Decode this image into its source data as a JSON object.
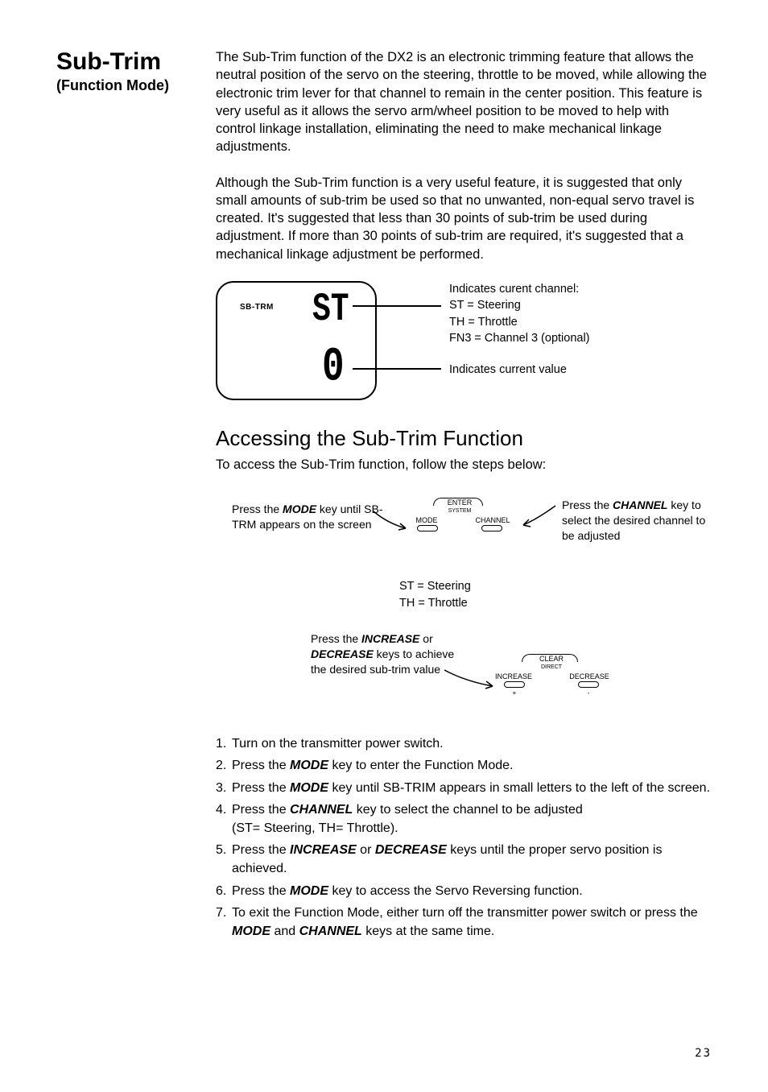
{
  "side": {
    "title": "Sub-Trim",
    "subtitle": "(Function Mode)"
  },
  "para1": "The Sub-Trim function of the DX2 is an electronic trimming feature that allows the neutral position of the servo on the steering, throttle to be moved, while allowing the electronic trim lever for that channel to remain in the center position. This feature is very useful as it allows the servo arm/wheel position to be moved to help with control linkage installation, eliminating the need to make mechanical linkage adjustments.",
  "para2": "Although the Sub-Trim function is a very useful feature, it is suggested that only small amounts of sub-trim be used so that no unwanted, non-equal servo travel is created. It's suggested that less than 30 points of sub-trim be used during adjustment. If more than 30 points of sub-trim are required, it's suggested that a mechanical linkage adjustment be performed.",
  "lcd": {
    "label": "SB-TRM",
    "seg1": "ST",
    "seg2": "0",
    "cap_top_line1": "Indicates curent channel:",
    "cap_top_line2": "ST = Steering",
    "cap_top_line3": "TH = Throttle",
    "cap_top_line4": "FN3 = Channel 3 (optional)",
    "cap_bot": "Indicates current value"
  },
  "h2": "Accessing the Sub-Trim Function",
  "h2_sub": "To access the Sub-Trim function, follow the steps below:",
  "d1": {
    "left_pre": "Press the ",
    "left_key": "MODE",
    "left_post": " key until SB-TRM appears on the screen",
    "right_pre": "Press the ",
    "right_key": "CHANNEL",
    "right_post": " key to select the desired channel to be adjusted",
    "btn_top": "ENTER",
    "btn_sys": "SYSTEM",
    "btn_l": "MODE",
    "btn_r": "CHANNEL",
    "mid1": "ST = Steering",
    "mid2": "TH = Throttle"
  },
  "d2": {
    "cap_pre": "Press the ",
    "cap_k1": "INCREASE",
    "cap_mid": " or ",
    "cap_k2": "DECREASE",
    "cap_post": " keys to achieve the desired sub-trim value",
    "btn_top": "CLEAR",
    "btn_sys": "DIRECT",
    "btn_l": "INCREASE",
    "btn_r": "DECREASE",
    "sign_l": "+",
    "sign_r": "-"
  },
  "steps": {
    "s1": "Turn on the transmitter power switch.",
    "s2a": "Press the ",
    "s2k": "MODE",
    "s2b": " key to enter the Function Mode.",
    "s3a": "Press the ",
    "s3k": "MODE",
    "s3b": " key until SB-TRIM appears in small letters to the left of the screen.",
    "s4a": "Press the ",
    "s4k": "CHANNEL",
    "s4b": " key to select the channel to be adjusted",
    "s4c": "(ST= Steering, TH= Throttle).",
    "s5a": "Press the ",
    "s5k1": "INCREASE",
    "s5m": " or ",
    "s5k2": "DECREASE",
    "s5b": " keys until the proper servo position is achieved.",
    "s6a": "Press the ",
    "s6k": "MODE",
    "s6b": " key to access the Servo Reversing function.",
    "s7a": "To exit the Function Mode, either turn off the transmitter power switch or press the ",
    "s7k1": "MODE",
    "s7m": " and ",
    "s7k2": "CHANNEL",
    "s7b": " keys at the same time."
  },
  "page": "23"
}
